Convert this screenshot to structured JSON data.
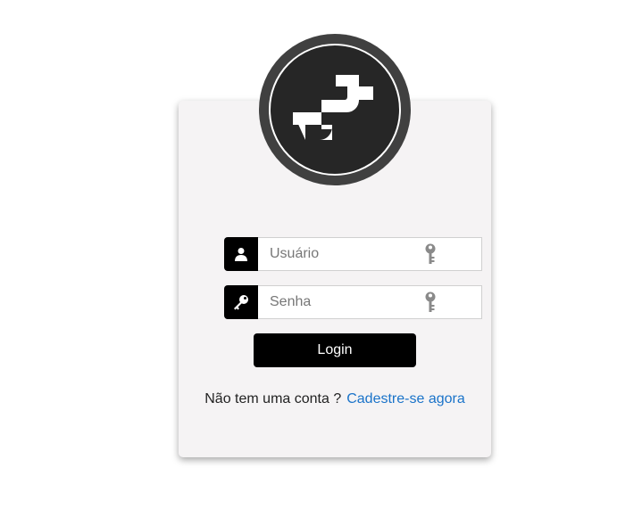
{
  "form": {
    "username_placeholder": "Usuário",
    "username_value": "",
    "password_placeholder": "Senha",
    "password_value": "",
    "login_label": "Login"
  },
  "signup": {
    "prompt": "Não tem uma conta ?",
    "link_label": "Cadestre-se agora"
  },
  "icons": {
    "logo": "brand-logo-icon",
    "username": "user-icon",
    "password": "key-icon",
    "input_suffix": "key-outline-icon"
  },
  "colors": {
    "button": "#000000",
    "link": "#1a73c9",
    "card": "#f5f3f4",
    "logo_ring": "#404040",
    "logo_inner": "#262626"
  }
}
